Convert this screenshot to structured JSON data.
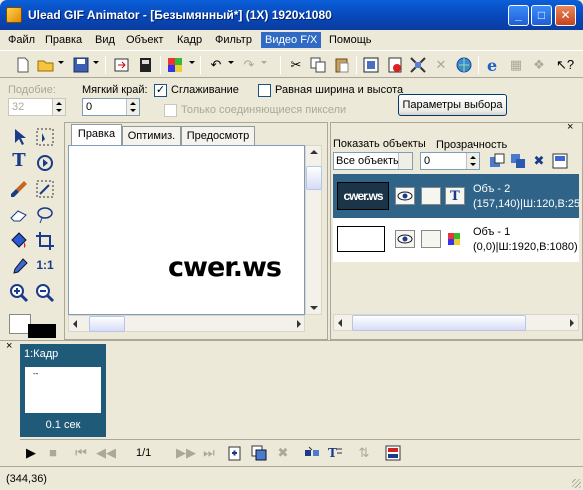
{
  "window": {
    "title": "Ulead GIF Animator - [Безымянный*] (1X) 1920x1080",
    "min": "_",
    "max": "□",
    "close": "✕"
  },
  "menu": [
    "Файл",
    "Правка",
    "Вид",
    "Объект",
    "Кадр",
    "Фильтр",
    "Видео F/X",
    "Помощь"
  ],
  "menu_active_index": 6,
  "options": {
    "similarity_label": "Подобие:",
    "similarity_value": "32",
    "soft_edge_label": "Мягкий край:",
    "soft_edge_value": "0",
    "antialias_label": "Сглаживание",
    "antialias_checked": true,
    "antialias_mark": "✓",
    "equal_wh_label": "Равная ширина и высота",
    "equal_wh_checked": false,
    "connected_label": "Только соединяющиеся пиксели",
    "selection_params_button": "Параметры выбора"
  },
  "tools": {
    "text_tool_glyph": "T",
    "ratio_tool_glyph": "1:1"
  },
  "canvas_panel": {
    "tabs": [
      "Правка",
      "Оптимиз.",
      "Предосмотр"
    ],
    "selected_tab_index": 0,
    "canvas_text": "cwer.ws"
  },
  "objects_panel": {
    "show_objects_label": "Показать объекты",
    "transparency_label": "Прозрачность",
    "filter_value": "Все объекты",
    "transparency_value": "0",
    "objects": [
      {
        "name": "Объ - 2",
        "info": "(157,140)|Ш:120,В:25",
        "thumb_text": "cwer.ws",
        "type_glyph": "T",
        "selected": true
      },
      {
        "name": "Объ - 1",
        "info": "(0,0)|Ш:1920,В:1080)",
        "thumb_text": "",
        "type_glyph": "",
        "selected": false
      }
    ]
  },
  "frames_panel": {
    "frame_label": "1:Кадр",
    "frame_delay": "0.1 сек",
    "frame_thumb_text": "--",
    "counter": "1/1",
    "close_glyph": "×"
  },
  "status": {
    "text": "(344,36)"
  },
  "colors": {
    "title_blue": "#0a5fd8",
    "frame_selected": "#1f5a78",
    "object_selected": "#2f6488",
    "menu_highlight": "#316ac5"
  }
}
